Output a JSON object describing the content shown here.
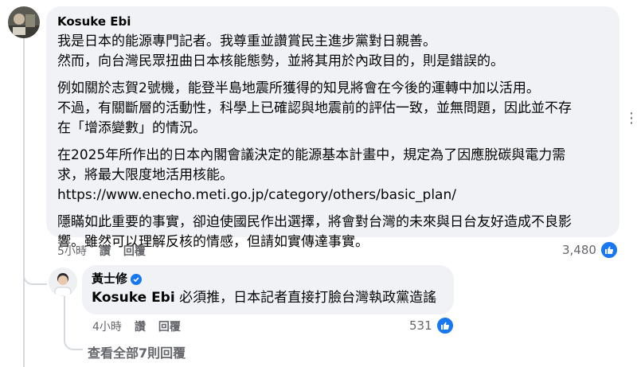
{
  "comment": {
    "author": "Kosuke Ebi",
    "paragraphs": [
      "我是日本的能源專門記者。我尊重並讚賞民主進步黨對日親善。\n然而，向台灣民眾扭曲日本核能態勢，並將其用於內政目的，則是錯誤的。",
      "例如關於志賀2號機，能登半島地震所獲得的知見將會在今後的運轉中加以活用。\n不過，有關斷層的活動性，科學上已確認與地震前的評估一致，並無問題，因此並不存\n在「增添變數」的情況。",
      "在2025年所作出的日本內閣會議決定的能源基本計畫中，規定為了因應脫碳與電力需\n求，將最大限度地活用核能。\nhttps://www.enecho.meti.go.jp/category/others/basic_plan/",
      "隱瞞如此重要的事實，卻迫使國民作出選擇，將會對台灣的未來與日台友好造成不良影\n響。雖然可以理解反核的情感，但請如實傳達事實。"
    ],
    "time": "5小時",
    "read_label": "讚",
    "reply_label": "回覆",
    "like_count": "3,480"
  },
  "reply": {
    "author": "黃士修",
    "mention": "Kosuke Ebi",
    "text": " 必須推，日本記者直接打臉台灣執政黨造謠",
    "time": "4小時",
    "read_label": "讚",
    "reply_label": "回覆",
    "like_count": "531"
  },
  "view_more": "查看全部7則回覆",
  "icons": {
    "like": "thumbs-up-icon",
    "verified": "verified-badge-icon",
    "more": "more-options-icon"
  },
  "colors": {
    "bubble": "#f0f2f5",
    "accent": "#1877f2",
    "secondary_text": "#65676b"
  }
}
